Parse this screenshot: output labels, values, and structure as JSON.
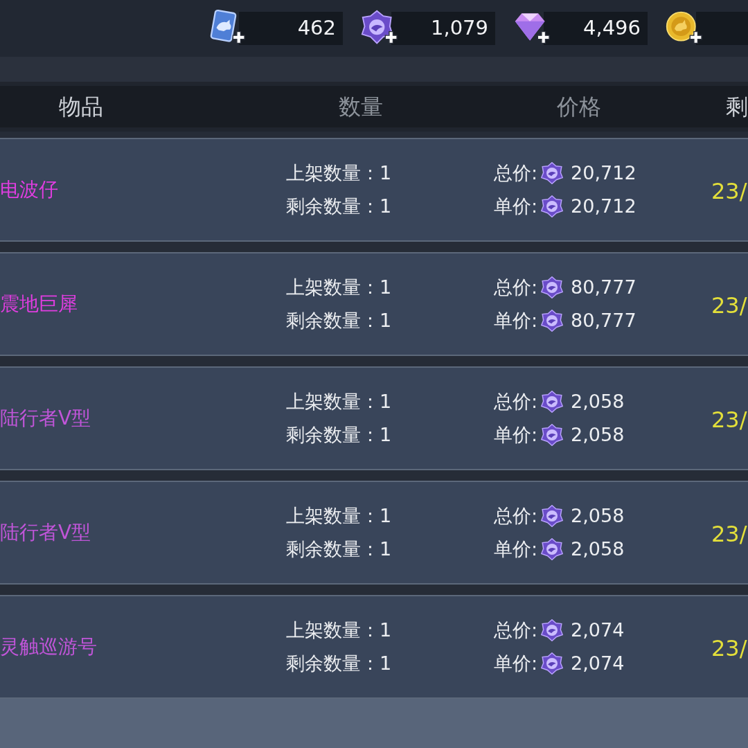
{
  "currencies": [
    {
      "kind": "card",
      "amount": "462"
    },
    {
      "kind": "emblem",
      "amount": "1,079"
    },
    {
      "kind": "diamond",
      "amount": "4,496"
    },
    {
      "kind": "coin"
    }
  ],
  "table": {
    "columns": [
      "物品",
      "数量",
      "价格",
      "剩"
    ],
    "rows": [
      {
        "name": "电波仔",
        "color": "#e03de0",
        "listed": "上架数量：1",
        "remaining": "剩余数量：1",
        "total_label": "总价:",
        "total": "20,712",
        "unit_label": "单价:",
        "unit": "20,712",
        "column_4": "23/"
      },
      {
        "name": "震地巨犀",
        "color": "#e03de0",
        "listed": "上架数量：1",
        "remaining": "剩余数量：1",
        "total_label": "总价:",
        "total": "80,777",
        "unit_label": "单价:",
        "unit": "80,777",
        "column_4": "23/"
      },
      {
        "name": "陆行者V型",
        "color": "#c055d8",
        "listed": "上架数量：1",
        "remaining": "剩余数量：1",
        "total_label": "总价:",
        "total": "2,058",
        "unit_label": "单价:",
        "unit": "2,058",
        "column_4": "23/"
      },
      {
        "name": "陆行者V型",
        "color": "#c055d8",
        "listed": "上架数量：1",
        "remaining": "剩余数量：1",
        "total_label": "总价:",
        "total": "2,058",
        "unit_label": "单价:",
        "unit": "2,058",
        "column_4": "23/"
      },
      {
        "name": "灵触巡游号",
        "color": "#c055d8",
        "listed": "上架数量：1",
        "remaining": "剩余数量：1",
        "total_label": "总价:",
        "total": "2,074",
        "unit_label": "单价:",
        "unit": "2,074",
        "column_4": "23/"
      }
    ]
  }
}
